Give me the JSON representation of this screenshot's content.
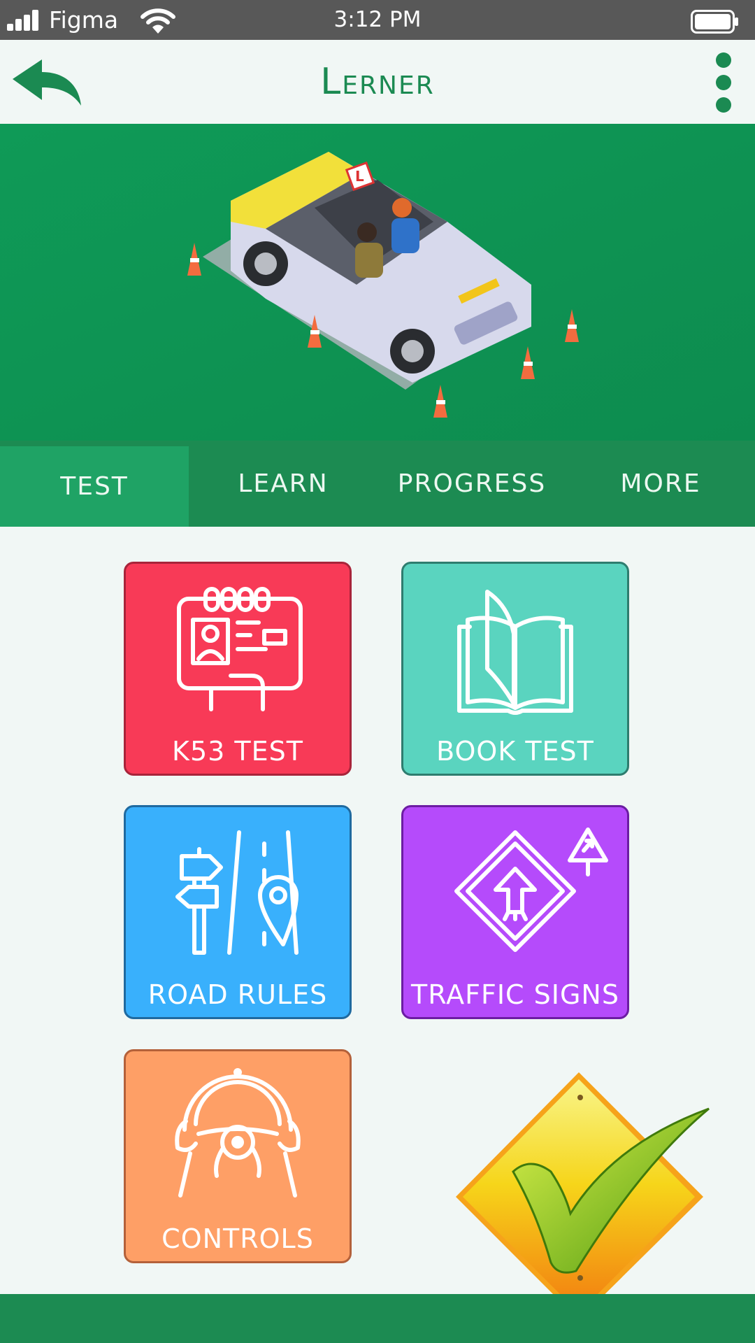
{
  "status_bar": {
    "carrier": "Figma",
    "time": "3:12 PM",
    "icons": [
      "signal-icon",
      "wifi-icon",
      "battery-icon"
    ]
  },
  "app_bar": {
    "title": "Lerner",
    "back_icon": "back-arrow-icon",
    "menu_icon": "kebab-menu-icon"
  },
  "hero": {
    "illustration": "driving-school-car-illustration"
  },
  "tabs": [
    {
      "label": "TEST",
      "active": true
    },
    {
      "label": "LEARN",
      "active": false
    },
    {
      "label": "PROGRESS",
      "active": false
    },
    {
      "label": "MORE",
      "active": false
    }
  ],
  "tiles": [
    {
      "label": "K53 TEST",
      "icon": "license-card-icon",
      "color": "#f83a57"
    },
    {
      "label": "BOOK TEST",
      "icon": "open-book-icon",
      "color": "#5ad4bf"
    },
    {
      "label": "ROAD RULES",
      "icon": "road-signpost-icon",
      "color": "#39b0fc"
    },
    {
      "label": "TRAFFIC SIGNS",
      "icon": "traffic-sign-icon",
      "color": "#b54bfb"
    },
    {
      "label": "CONTROLS",
      "icon": "steering-wheel-icon",
      "color": "#fe9f66"
    }
  ],
  "decoration": {
    "icon": "checkmark-sign-icon"
  },
  "colors": {
    "primary": "#1c8b52",
    "hero_bg": "#0f9a57",
    "active_tab": "#1fa365",
    "background": "#f1f7f5"
  }
}
